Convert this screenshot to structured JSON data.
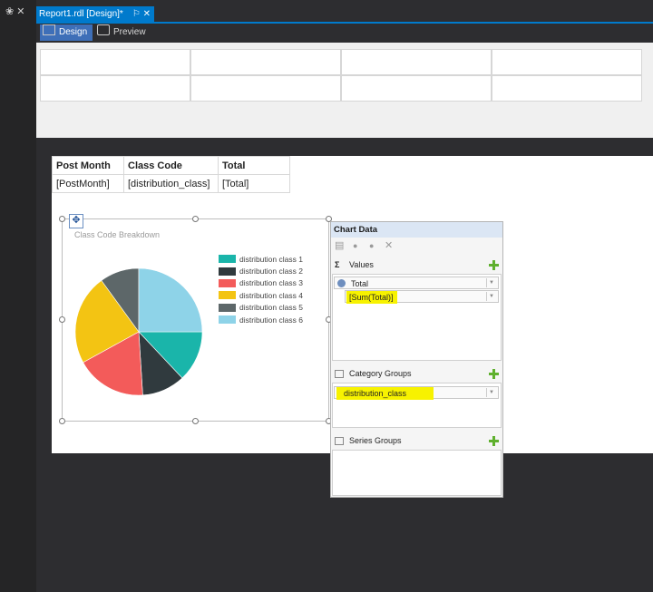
{
  "window": {
    "pin_glyph": "❀ ✕",
    "tab_title": "Report1.rdl [Design]*",
    "tab_icons": "⚐ ✕"
  },
  "toolbar": {
    "design_label": "Design",
    "preview_label": "Preview"
  },
  "table": {
    "headers": [
      "Post Month",
      "Class Code",
      "Total"
    ],
    "cells": [
      "[PostMonth]",
      "[distribution_class]",
      "[Total]"
    ]
  },
  "chart": {
    "title": "Class Code Breakdown",
    "legend": [
      {
        "label": "distribution class 1",
        "color": "#1ab5aa"
      },
      {
        "label": "distribution class 2",
        "color": "#303a3e"
      },
      {
        "label": "distribution class 3",
        "color": "#f35b5a"
      },
      {
        "label": "distribution class 4",
        "color": "#f3c413"
      },
      {
        "label": "distribution class 5",
        "color": "#5d6769"
      },
      {
        "label": "distribution class 6",
        "color": "#8ed3e8"
      }
    ]
  },
  "chart_data": {
    "type": "pie",
    "title": "Class Code Breakdown",
    "categories": [
      "distribution class 1",
      "distribution class 2",
      "distribution class 3",
      "distribution class 4",
      "distribution class 5",
      "distribution class 6"
    ],
    "values": [
      13,
      11,
      18,
      23,
      10,
      25
    ],
    "colors": [
      "#1ab5aa",
      "#303a3e",
      "#f35b5a",
      "#f3c413",
      "#5d6769",
      "#8ed3e8"
    ],
    "legend_position": "right"
  },
  "panel": {
    "title": "Chart Data",
    "values_label": "Values",
    "values_field": "Total",
    "values_expr": "[Sum(Total)]",
    "category_label": "Category Groups",
    "category_field": "distribution_class",
    "series_label": "Series Groups"
  },
  "colors": {
    "accent": "#007acc",
    "highlight": "#f7f200"
  }
}
